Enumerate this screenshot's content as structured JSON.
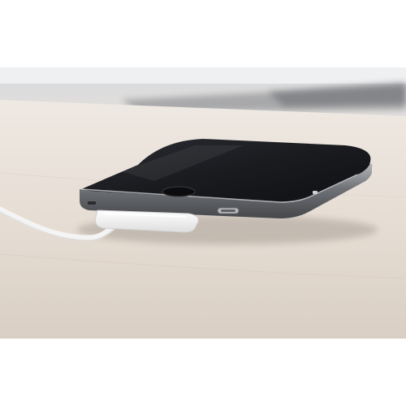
{
  "scene": {
    "subject": "smartphone",
    "accessory": "charging-cable",
    "surface": "table",
    "colors": {
      "margin": "#ffffff",
      "background_top": "#dcdee0",
      "surface_light": "#ece5dd",
      "surface_shadow": "#cfc6bd",
      "phone_glass": "#1b1c20",
      "phone_frame": "#8e9094",
      "cable": "#f7f7f7"
    }
  }
}
